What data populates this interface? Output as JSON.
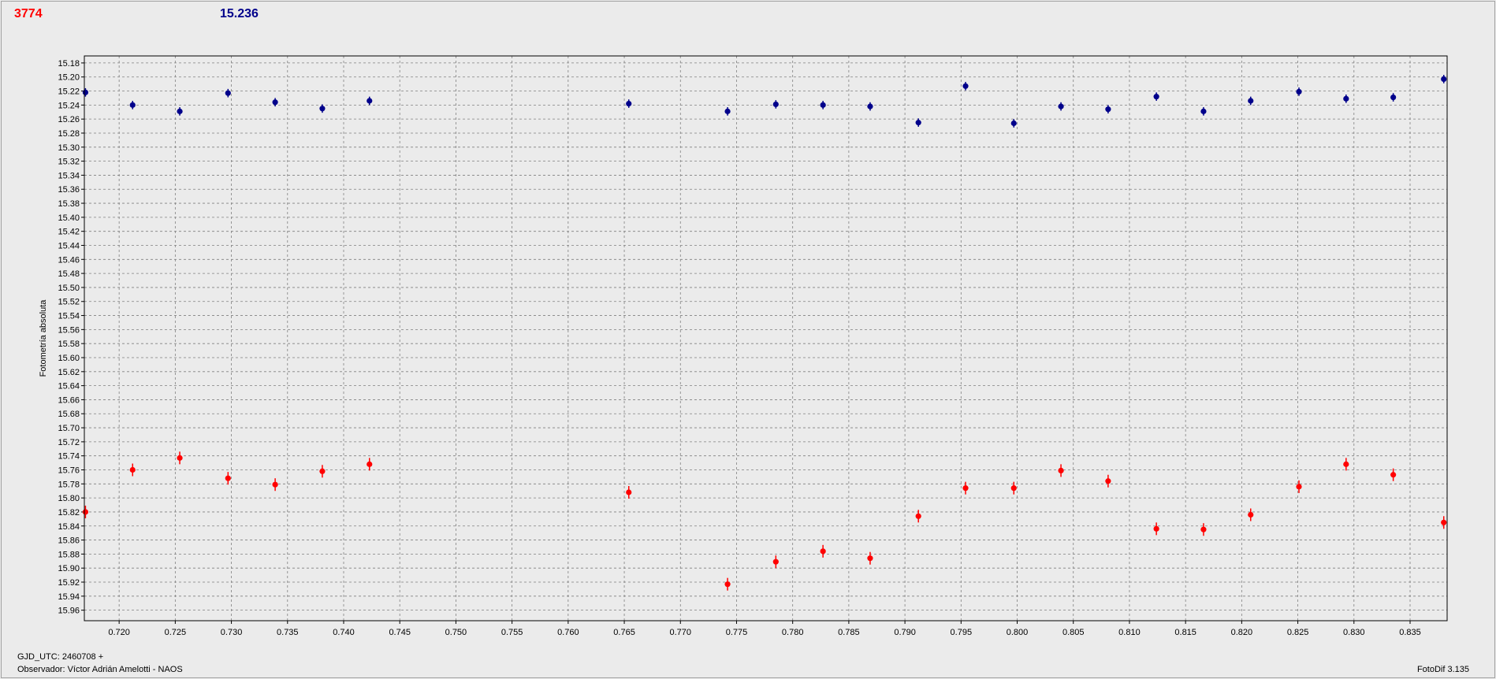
{
  "header": {
    "red_value": "3774",
    "blue_value": "15.236"
  },
  "footer": {
    "gjd": "GJD_UTC: 2460708 +",
    "observer": "Observador: Víctor Adrián Amelotti - NAOS",
    "version": "FotoDif 3.135"
  },
  "colors": {
    "red_series": "#ff0000",
    "blue_series": "#00008b",
    "grid": "#808080",
    "plot_background": "#ebebeb"
  },
  "chart_data": {
    "type": "scatter",
    "title": "",
    "xlabel": "",
    "ylabel": "Fotometría absoluta",
    "xlim": [
      0.7169,
      0.8383
    ],
    "ylim": [
      15.17,
      15.975
    ],
    "y_inverted": true,
    "grid": true,
    "x_ticks": [
      "0.720",
      "0.725",
      "0.730",
      "0.735",
      "0.740",
      "0.745",
      "0.750",
      "0.755",
      "0.760",
      "0.765",
      "0.770",
      "0.775",
      "0.780",
      "0.785",
      "0.790",
      "0.795",
      "0.800",
      "0.805",
      "0.810",
      "0.815",
      "0.820",
      "0.825",
      "0.830",
      "0.835"
    ],
    "y_ticks": [
      "15.18",
      "15.20",
      "15.22",
      "15.24",
      "15.26",
      "15.28",
      "15.30",
      "15.32",
      "15.34",
      "15.36",
      "15.38",
      "15.40",
      "15.42",
      "15.44",
      "15.46",
      "15.48",
      "15.50",
      "15.52",
      "15.54",
      "15.56",
      "15.58",
      "15.60",
      "15.62",
      "15.64",
      "15.66",
      "15.68",
      "15.70",
      "15.72",
      "15.74",
      "15.76",
      "15.78",
      "15.80",
      "15.82",
      "15.84",
      "15.86",
      "15.88",
      "15.90",
      "15.92",
      "15.94",
      "15.96"
    ],
    "series": [
      {
        "color": "#00008b",
        "x": [
          0.717,
          0.7212,
          0.7254,
          0.7297,
          0.7339,
          0.7381,
          0.7423,
          0.7654,
          0.7742,
          0.7785,
          0.7827,
          0.7869,
          0.7912,
          0.7954,
          0.7997,
          0.8039,
          0.8081,
          0.8124,
          0.8166,
          0.8208,
          0.8251,
          0.8293,
          0.8335,
          0.838
        ],
        "y": [
          15.222,
          15.24,
          15.249,
          15.223,
          15.236,
          15.245,
          15.234,
          15.238,
          15.249,
          15.239,
          15.24,
          15.242,
          15.265,
          15.213,
          15.266,
          15.242,
          15.246,
          15.228,
          15.249,
          15.234,
          15.221,
          15.231,
          15.229,
          15.203
        ],
        "err": [
          0.006,
          0.006,
          0.006,
          0.006,
          0.006,
          0.006,
          0.006,
          0.006,
          0.006,
          0.006,
          0.006,
          0.006,
          0.006,
          0.006,
          0.006,
          0.006,
          0.006,
          0.006,
          0.006,
          0.006,
          0.006,
          0.006,
          0.006,
          0.006
        ]
      },
      {
        "color": "#ff0000",
        "x": [
          0.717,
          0.7212,
          0.7254,
          0.7297,
          0.7339,
          0.7381,
          0.7423,
          0.7654,
          0.7742,
          0.7785,
          0.7827,
          0.7869,
          0.7912,
          0.7954,
          0.7997,
          0.8039,
          0.8081,
          0.8124,
          0.8166,
          0.8208,
          0.8251,
          0.8293,
          0.8335,
          0.838
        ],
        "y": [
          15.82,
          15.76,
          15.743,
          15.772,
          15.781,
          15.762,
          15.752,
          15.792,
          15.923,
          15.891,
          15.876,
          15.886,
          15.826,
          15.786,
          15.786,
          15.761,
          15.776,
          15.844,
          15.845,
          15.824,
          15.784,
          15.752,
          15.767,
          15.835
        ],
        "err": [
          0.009,
          0.009,
          0.009,
          0.009,
          0.009,
          0.009,
          0.009,
          0.009,
          0.009,
          0.009,
          0.009,
          0.009,
          0.009,
          0.009,
          0.009,
          0.009,
          0.009,
          0.009,
          0.009,
          0.009,
          0.009,
          0.009,
          0.009,
          0.009
        ]
      }
    ]
  }
}
